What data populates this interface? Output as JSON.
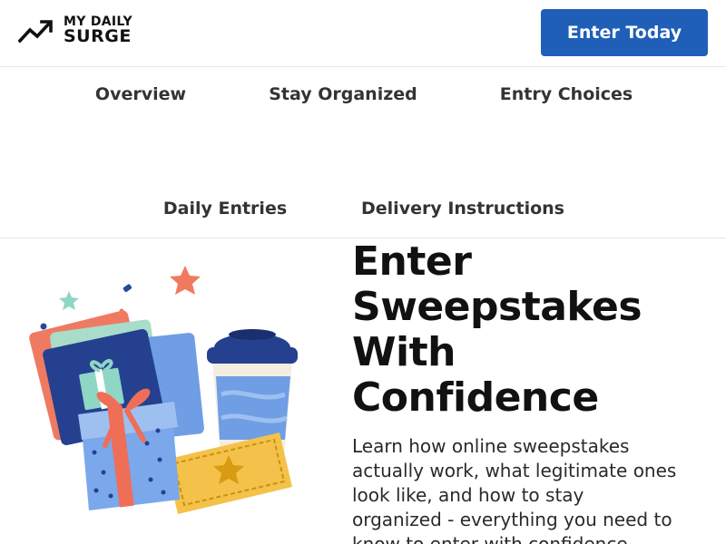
{
  "header": {
    "logo_line1": "MY DAILY",
    "logo_line2": "SURGE",
    "cta_label": "Enter Today",
    "logo_icon": "trending-up-icon"
  },
  "nav": {
    "items": [
      {
        "label": "Overview"
      },
      {
        "label": "Stay Organized"
      },
      {
        "label": "Entry Choices"
      },
      {
        "label": "Daily Entries"
      },
      {
        "label": "Delivery Instructions"
      }
    ]
  },
  "hero": {
    "title_lines": [
      "Enter",
      "Sweepstakes",
      "With",
      "Confidence"
    ],
    "description": "Learn how online sweepstakes actually work, what legitimate ones look like, and how to stay organized - everything you need to know to enter with confidence."
  },
  "colors": {
    "accent": "#1f5fb8",
    "text": "#111111",
    "divider": "#e6e6e6"
  }
}
